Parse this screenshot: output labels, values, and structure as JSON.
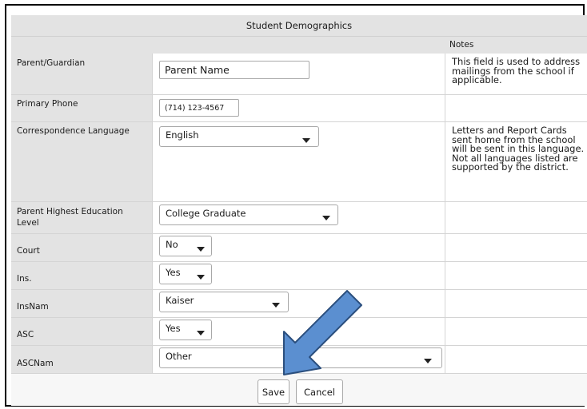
{
  "form": {
    "title": "Student Demographics",
    "notes_header": "Notes"
  },
  "fields": {
    "parent_guardian": {
      "label": "Parent/Guardian",
      "value": "Parent Name",
      "note": "This field is used to address mailings from the school if applicable."
    },
    "primary_phone": {
      "label": "Primary Phone",
      "value": "(714) 123-4567"
    },
    "correspondence_language": {
      "label": "Correspondence Language",
      "value": "English",
      "note": "Letters and Report Cards sent home from the school will be sent in this language. Not all languages listed are supported by the district."
    },
    "parent_education": {
      "label": "Parent Highest Education Level",
      "value": "College Graduate"
    },
    "court": {
      "label": "Court",
      "value": "No"
    },
    "ins": {
      "label": "Ins.",
      "value": "Yes"
    },
    "insnam": {
      "label": "InsNam",
      "value": "Kaiser"
    },
    "asc": {
      "label": "ASC",
      "value": "Yes"
    },
    "ascnam": {
      "label": "ASCNam",
      "value": "Other"
    }
  },
  "buttons": {
    "save": "Save",
    "cancel": "Cancel"
  },
  "colors": {
    "label_bg": "#e3e3e3",
    "arrow_fill": "#5b8fd0",
    "arrow_stroke": "#2b4f7e"
  }
}
